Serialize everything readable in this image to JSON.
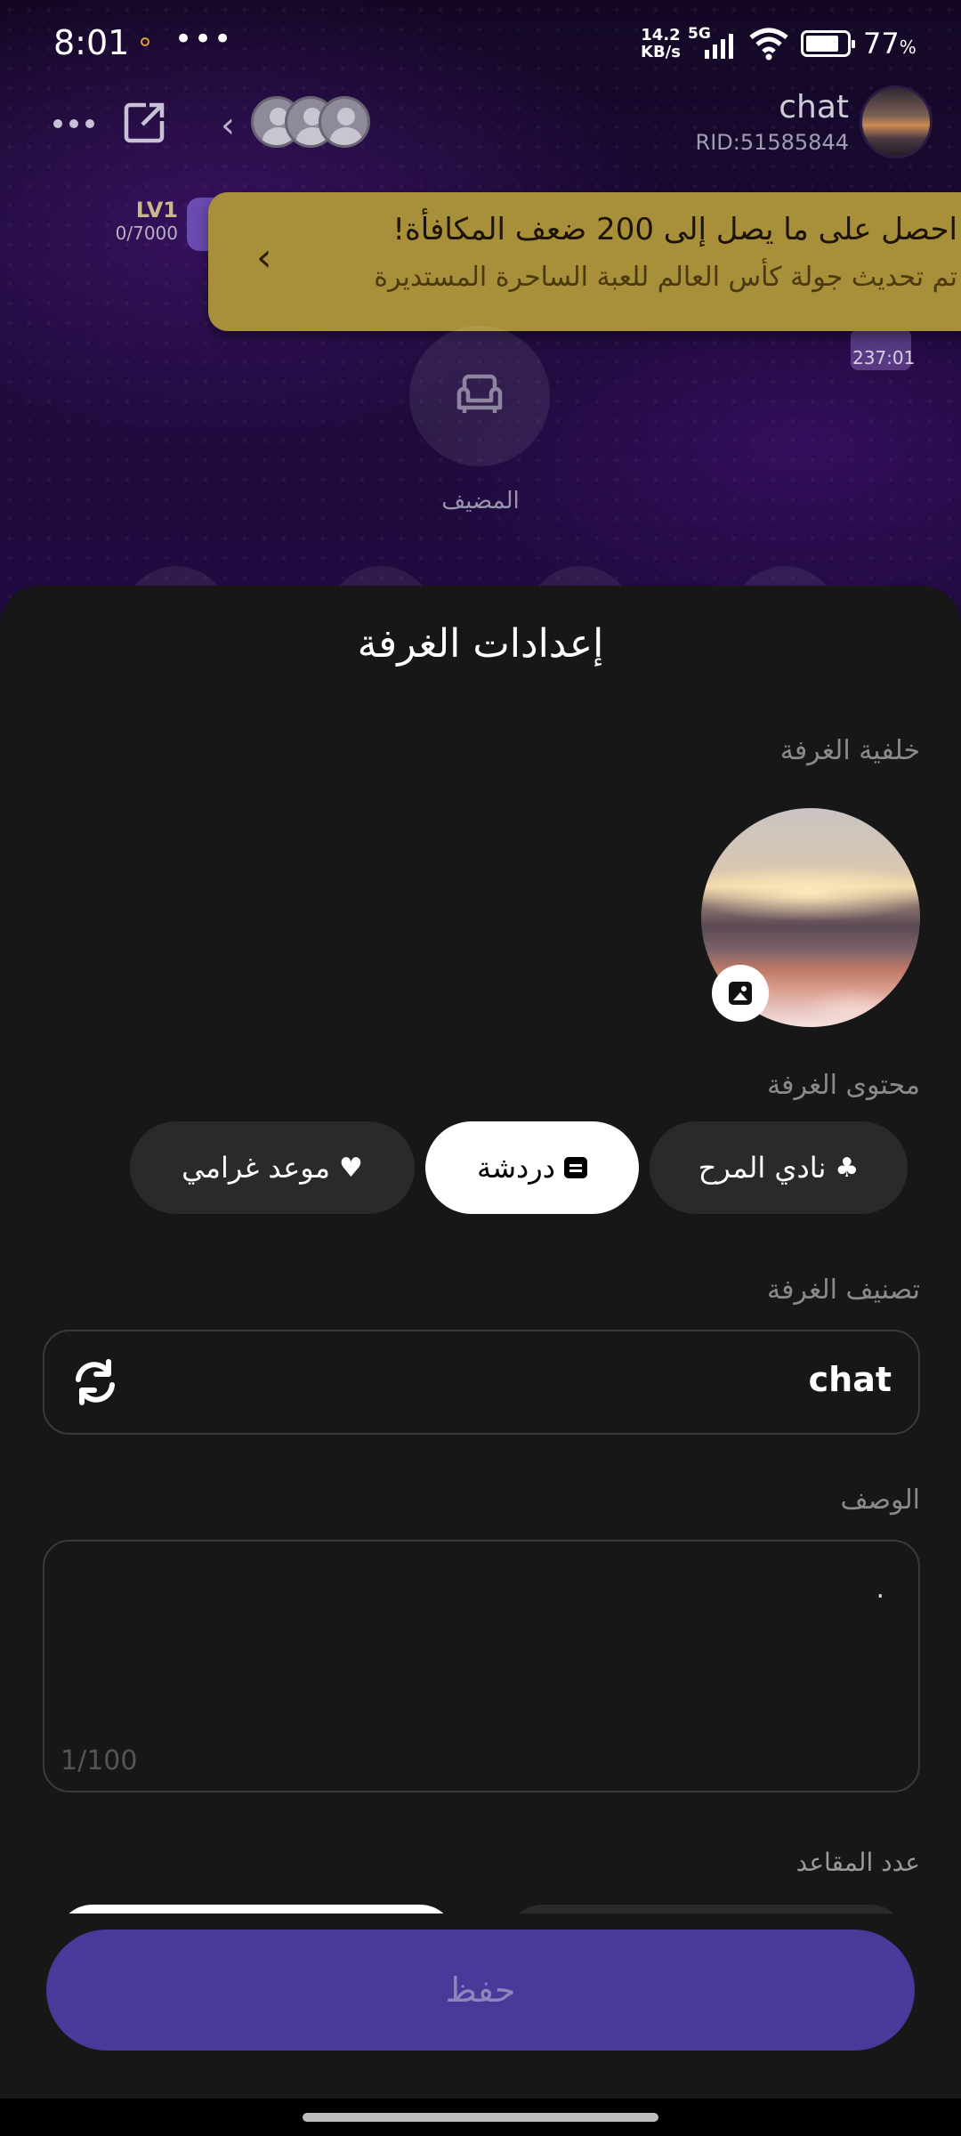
{
  "status_bar": {
    "time": "8:01",
    "net_speed_value": "14.2",
    "net_speed_unit": "KB/s",
    "network": "5G",
    "battery": "77",
    "battery_unit": "%"
  },
  "room": {
    "name": "chat",
    "rid": "RID:51585844",
    "level": "LV1",
    "level_progress": "0/7000",
    "host_label": "المضيف",
    "timer": "237:01"
  },
  "promo": {
    "title": "احصل على ما يصل إلى 200 ضعف المكافأة!",
    "subtitle": "تم تحديث جولة كأس العالم للعبة الساحرة المستديرة"
  },
  "sheet": {
    "title": "إعدادات الغرفة",
    "background_label": "خلفية الغرفة",
    "content_label": "محتوى الغرفة",
    "content_options": [
      {
        "label": "نادي المرح",
        "icon": "club-icon",
        "selected": false
      },
      {
        "label": "دردشة",
        "icon": "chat-icon",
        "selected": true
      },
      {
        "label": "موعد غرامي",
        "icon": "heart-icon",
        "selected": false
      }
    ],
    "category_label": "تصنيف الغرفة",
    "category_value": "chat",
    "description_label": "الوصف",
    "description_value": ".",
    "description_count": "1/100",
    "seats_label": "عدد المقاعد",
    "save_label": "حفظ"
  },
  "colors": {
    "accent": "#483a98",
    "promo_bg": "#a8903b",
    "sheet_bg": "#171717"
  }
}
